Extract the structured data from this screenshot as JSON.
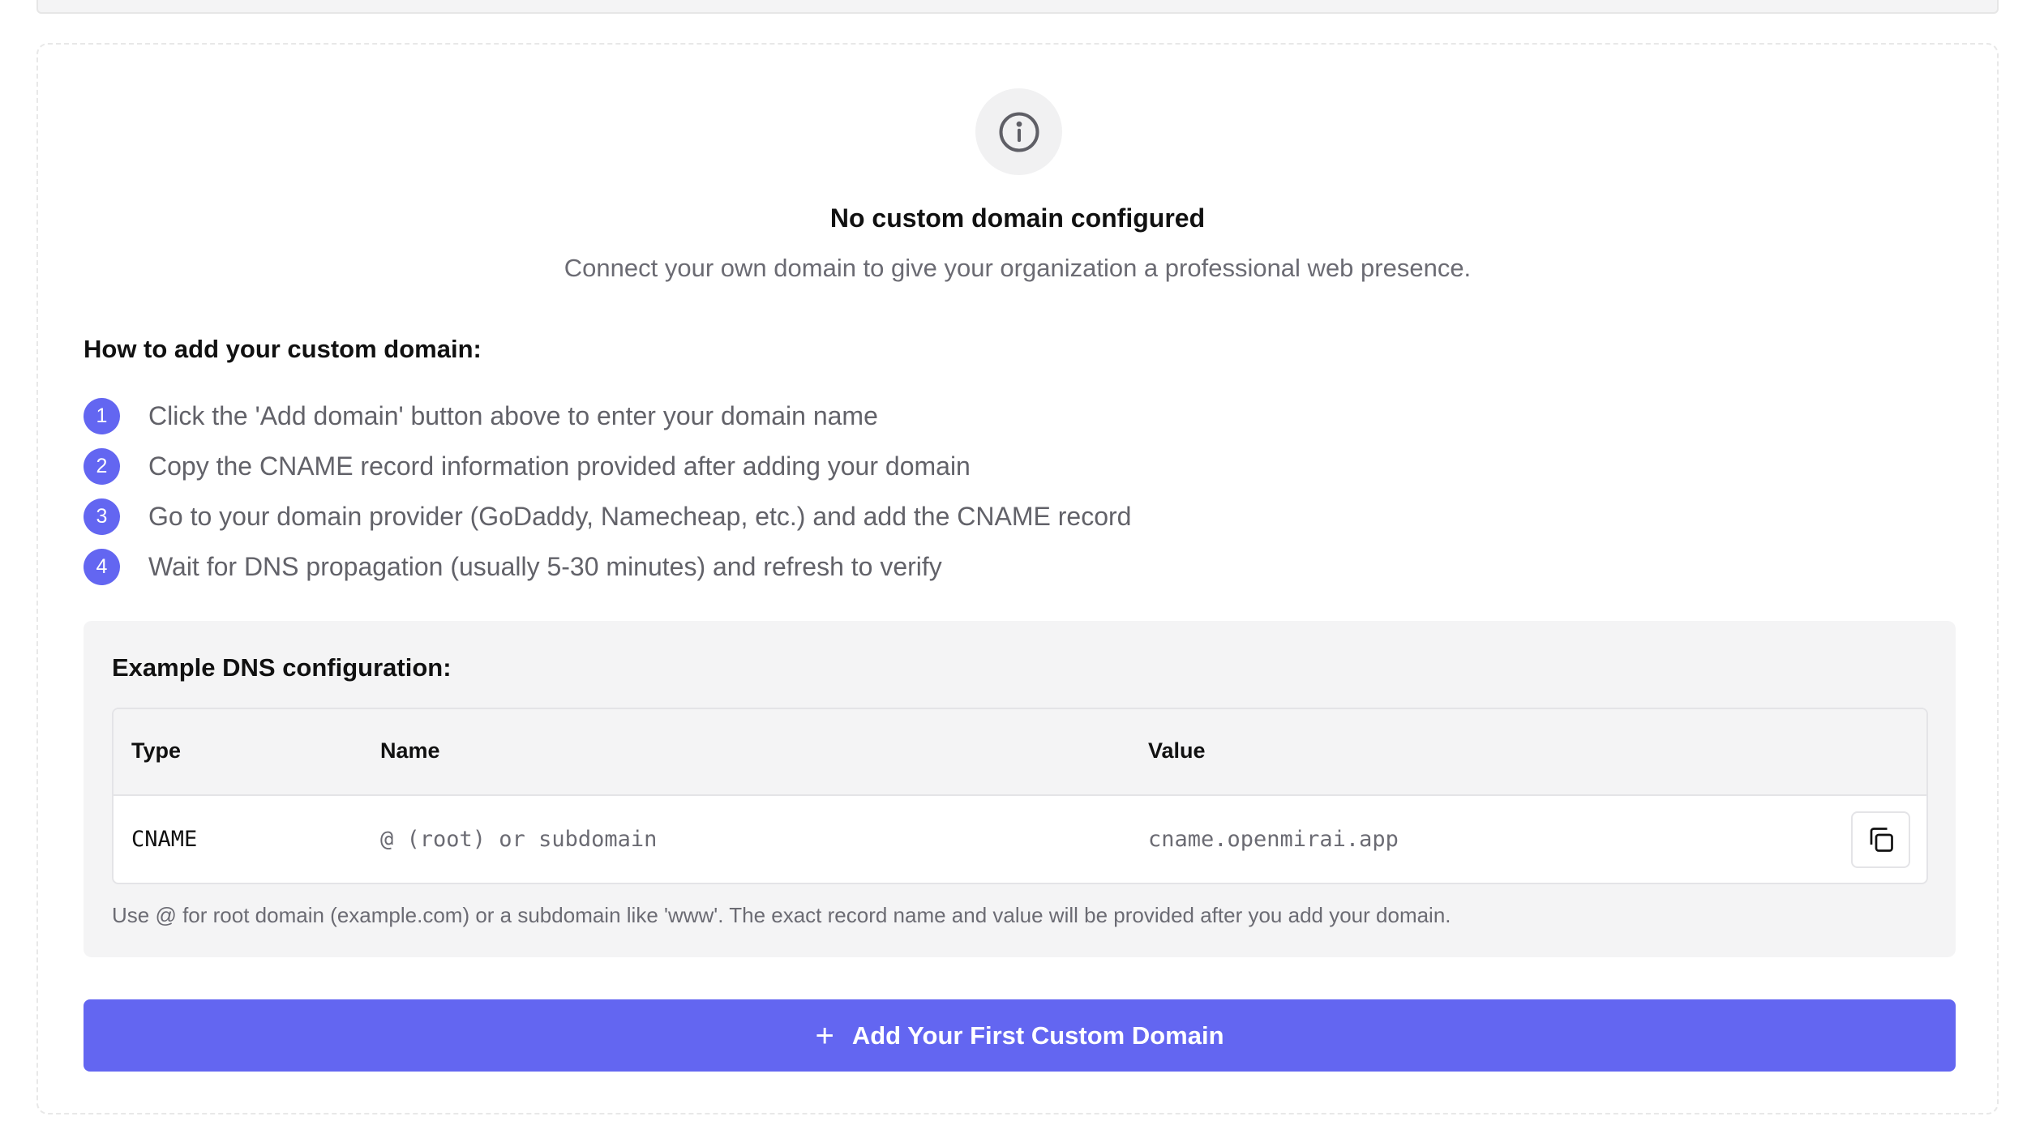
{
  "empty_state": {
    "icon": "info-icon",
    "title": "No custom domain configured",
    "subtitle": "Connect your own domain to give your organization a professional web presence."
  },
  "howto": {
    "title": "How to add your custom domain:",
    "steps": [
      {
        "num": "1",
        "text": "Click the 'Add domain' button above to enter your domain name"
      },
      {
        "num": "2",
        "text": "Copy the CNAME record information provided after adding your domain"
      },
      {
        "num": "3",
        "text": "Go to your domain provider (GoDaddy, Namecheap, etc.) and add the CNAME record"
      },
      {
        "num": "4",
        "text": "Wait for DNS propagation (usually 5-30 minutes) and refresh to verify"
      }
    ]
  },
  "dns_example": {
    "title": "Example DNS configuration:",
    "columns": [
      "Type",
      "Name",
      "Value"
    ],
    "row": {
      "type": "CNAME",
      "name": "@ (root) or subdomain",
      "value": "cname.openmirai.app"
    },
    "copy_icon": "copy-icon",
    "note": "Use @ for root domain (example.com) or a subdomain like 'www'. The exact record name and value will be provided after you add your domain."
  },
  "add_button": {
    "icon": "plus-icon",
    "label": "Add Your First Custom Domain"
  },
  "colors": {
    "accent": "#6366f1",
    "panel_bg": "#f4f4f5",
    "muted_text": "#6b6b73"
  }
}
